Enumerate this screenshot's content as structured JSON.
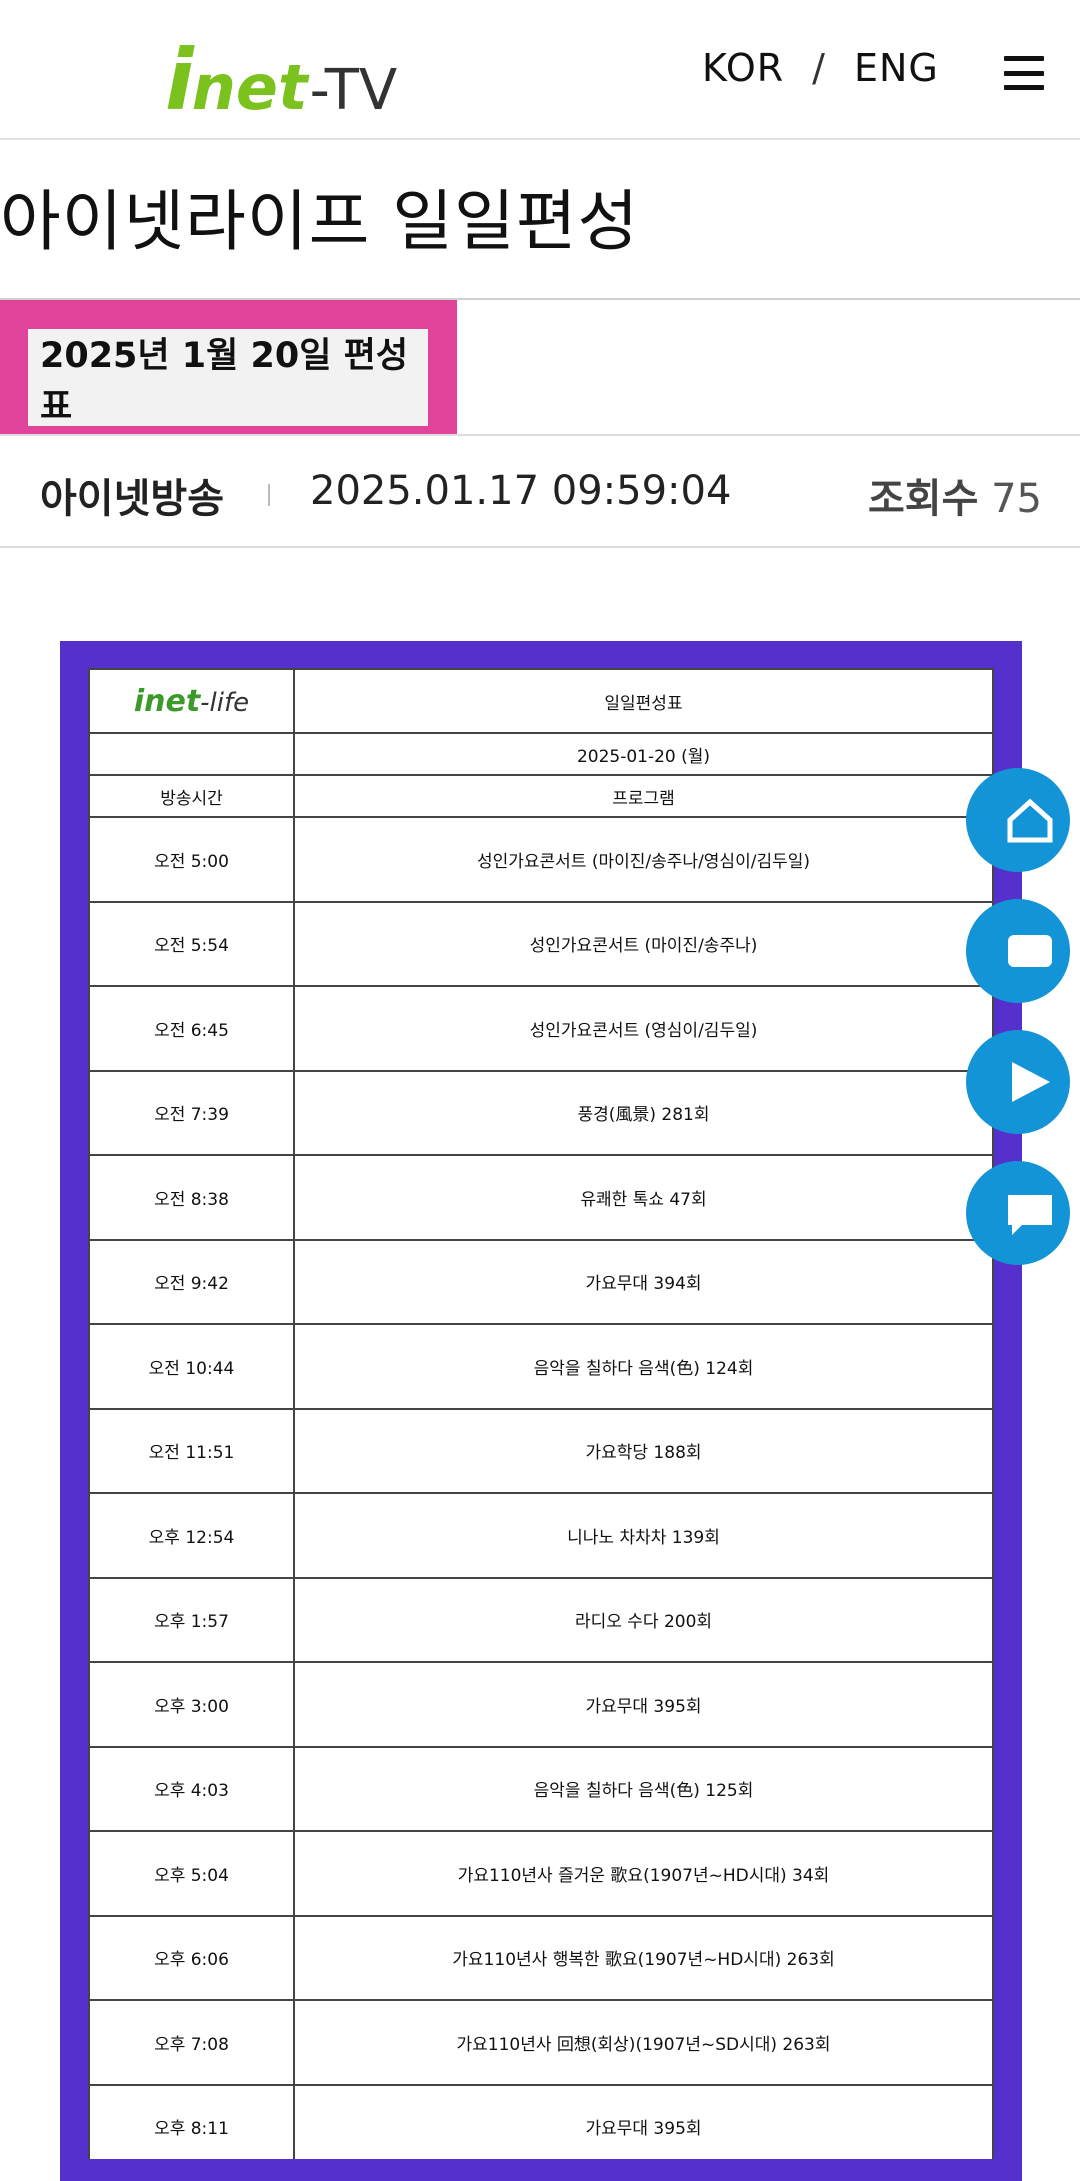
{
  "header": {
    "logo_i": "i",
    "logo_net": "net",
    "logo_tv": "-TV",
    "lang_kor": "KOR",
    "lang_sep": "/",
    "lang_eng": "ENG"
  },
  "page": {
    "title": "아이넷라이프 일일편성"
  },
  "tab": {
    "label": "2025년 1월 20일 편성표"
  },
  "meta": {
    "author": "아이넷방송",
    "datetime": "2025.01.17 09:59:04",
    "views_label": "조회수",
    "views_count": "75"
  },
  "schedule": {
    "logo_main": "inet",
    "logo_sub": "-life",
    "sheet_title": "일일편성표",
    "date": "2025-01-20 (월)",
    "col_time": "방송시간",
    "col_program": "프로그램",
    "rows": [
      {
        "time": "오전 5:00",
        "program": "성인가요콘서트 (마이진/송주나/영심이/김두일)"
      },
      {
        "time": "오전 5:54",
        "program": "성인가요콘서트 (마이진/송주나)"
      },
      {
        "time": "오전 6:45",
        "program": "성인가요콘서트 (영심이/김두일)"
      },
      {
        "time": "오전 7:39",
        "program": "풍경(風景) 281회"
      },
      {
        "time": "오전 8:38",
        "program": "유쾌한 톡쇼 47회"
      },
      {
        "time": "오전 9:42",
        "program": "가요무대 394회"
      },
      {
        "time": "오전 10:44",
        "program": "음악을 칠하다 음색(色) 124회"
      },
      {
        "time": "오전 11:51",
        "program": "가요학당 188회"
      },
      {
        "time": "오후 12:54",
        "program": "니나노 차차차 139회"
      },
      {
        "time": "오후 1:57",
        "program": "라디오 수다 200회"
      },
      {
        "time": "오후 3:00",
        "program": "가요무대 395회"
      },
      {
        "time": "오후 4:03",
        "program": "음악을 칠하다 음색(色) 125회"
      },
      {
        "time": "오후 5:04",
        "program": "가요110년사 즐거운 歌요(1907년~HD시대) 34회"
      },
      {
        "time": "오후 6:06",
        "program": "가요110년사 행복한 歌요(1907년~HD시대) 263회"
      },
      {
        "time": "오후 7:08",
        "program": "가요110년사 回想(회상)(1907년~SD시대) 263회"
      },
      {
        "time": "오후 8:11",
        "program": "가요무대 395회"
      }
    ]
  },
  "colors": {
    "brand_green": "#7cc21f",
    "tab_accent": "#e0449b",
    "frame": "#5630cc",
    "fab": "#1394d7"
  },
  "fabs": [
    "home-icon",
    "message-icon",
    "play-icon",
    "chat-icon"
  ]
}
